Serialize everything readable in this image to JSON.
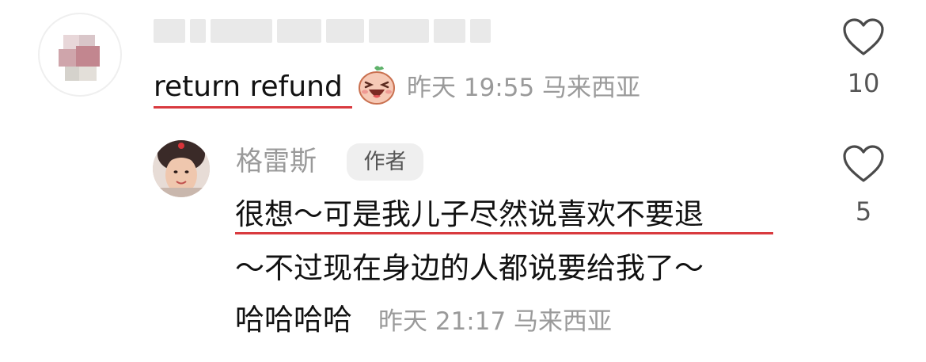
{
  "comment": {
    "text": "return refund",
    "meta": "昨天 19:55 马来西亚",
    "likes": "10",
    "emoji": "laughing-egg-emoji"
  },
  "reply": {
    "username": "格雷斯",
    "author_tag": "作者",
    "lines": [
      "很想～可是我儿子尽然说喜欢不要退",
      "～不过现在身边的人都说要给我了～",
      "哈哈哈哈"
    ],
    "meta": "昨天 21:17 马来西亚",
    "likes": "5"
  },
  "colors": {
    "underline": "#d93a3f",
    "meta_text": "#9a9a9a",
    "tag_bg": "#efefef"
  }
}
